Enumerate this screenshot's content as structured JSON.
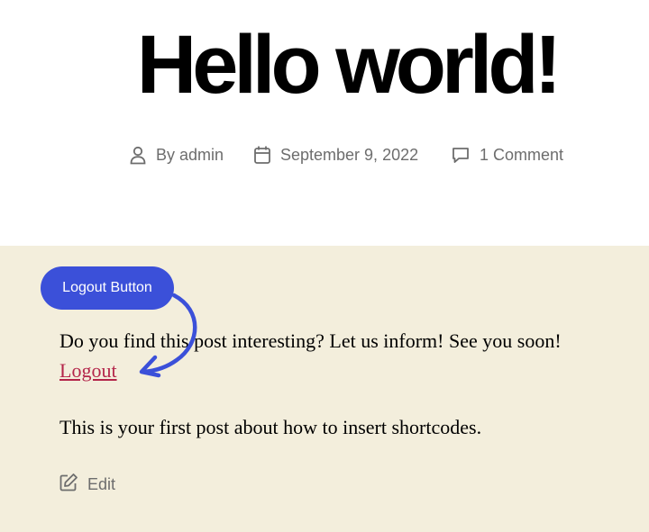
{
  "post": {
    "title": "Hello world!",
    "meta": {
      "author": "By admin",
      "date": "September 9, 2022",
      "comments": "1 Comment"
    }
  },
  "content": {
    "paragraph1": "Do you find this post interesting? Let us inform! See you soon!",
    "logout_link": "Logout",
    "paragraph2": "This is your first post about how to insert shortcodes.",
    "edit_label": "Edit"
  },
  "annotation": {
    "badge_label": "Logout Button",
    "color": "#3b50d9"
  },
  "colors": {
    "content_background": "#f3eedc",
    "link": "#b4254a",
    "meta_text": "#6d6d6d"
  },
  "icons": [
    "person-icon",
    "calendar-icon",
    "comment-icon",
    "edit-icon"
  ]
}
